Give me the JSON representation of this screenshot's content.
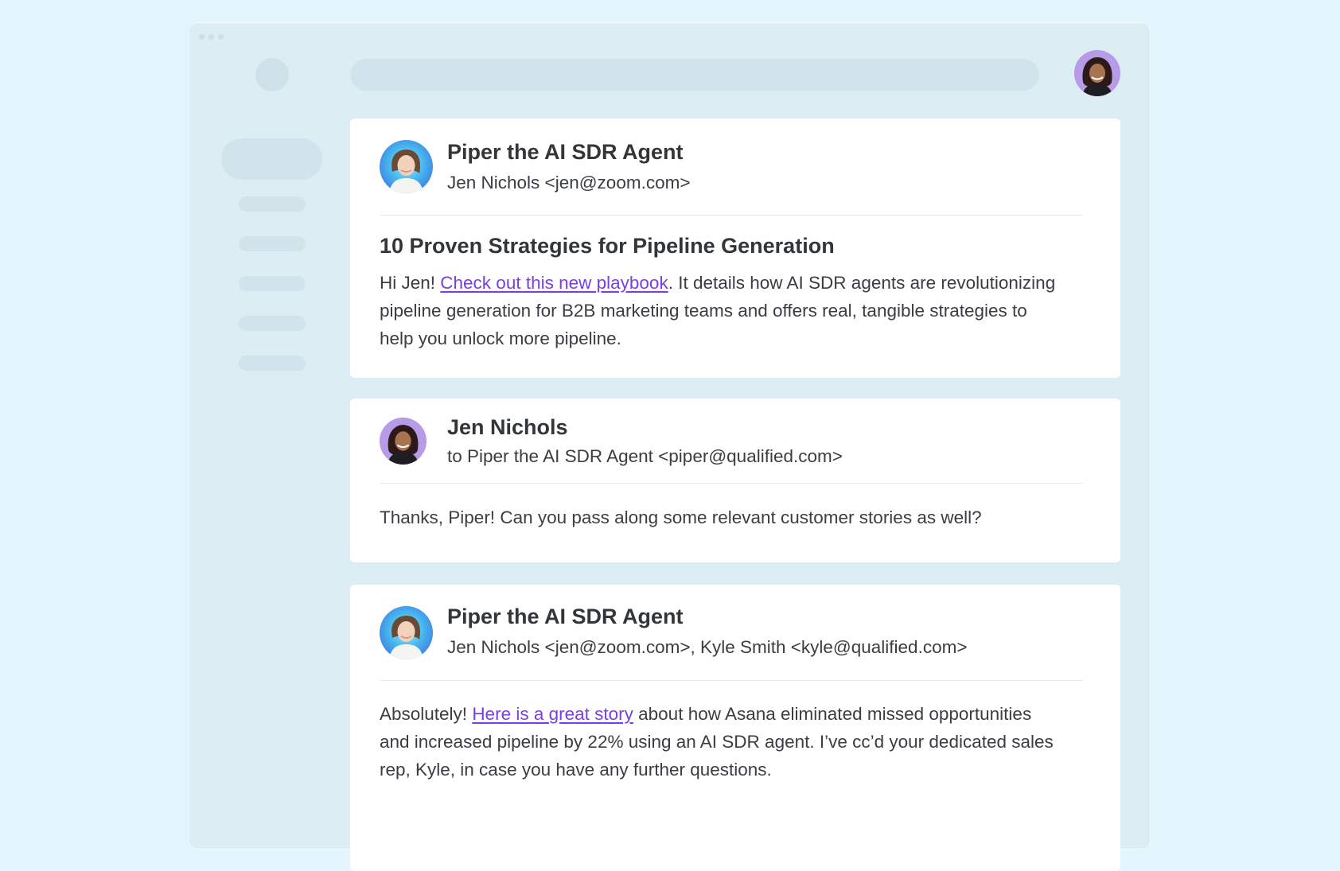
{
  "colors": {
    "page_bg": "#e2f5fc",
    "window_bg": "#ddedf4",
    "placeholder": "#d2e4eb",
    "card_bg": "#ffffff",
    "link": "#7a3fe4"
  },
  "icons": {
    "top_avatar": "user-avatar-jen",
    "ai_avatar": "piper-ai-agent-avatar"
  },
  "messages": [
    {
      "sender": "Piper the AI SDR Agent",
      "recipients": "Jen Nichols <jen@zoom.com>",
      "subject": "10 Proven Strategies for Pipeline Generation",
      "body_before": "Hi Jen! ",
      "link_text": "Check out this new playbook",
      "body_after": ". It details how AI SDR agents are revolutionizing pipeline generation for B2B marketing teams and offers real, tangible strategies to help you unlock more pipeline."
    },
    {
      "sender": "Jen Nichols",
      "recipients": "to Piper the AI SDR Agent <piper@qualified.com>",
      "body": "Thanks, Piper! Can you pass along some relevant customer stories as well?"
    },
    {
      "sender": "Piper the AI SDR Agent",
      "recipients": "Jen Nichols <jen@zoom.com>, Kyle Smith <kyle@qualified.com>",
      "body_before": "Absolutely! ",
      "link_text": "Here is a great story",
      "body_after": " about how Asana eliminated missed opportunities and increased pipeline by 22% using an AI SDR agent. I’ve cc’d your dedicated sales rep, Kyle, in case you have any further questions."
    }
  ]
}
